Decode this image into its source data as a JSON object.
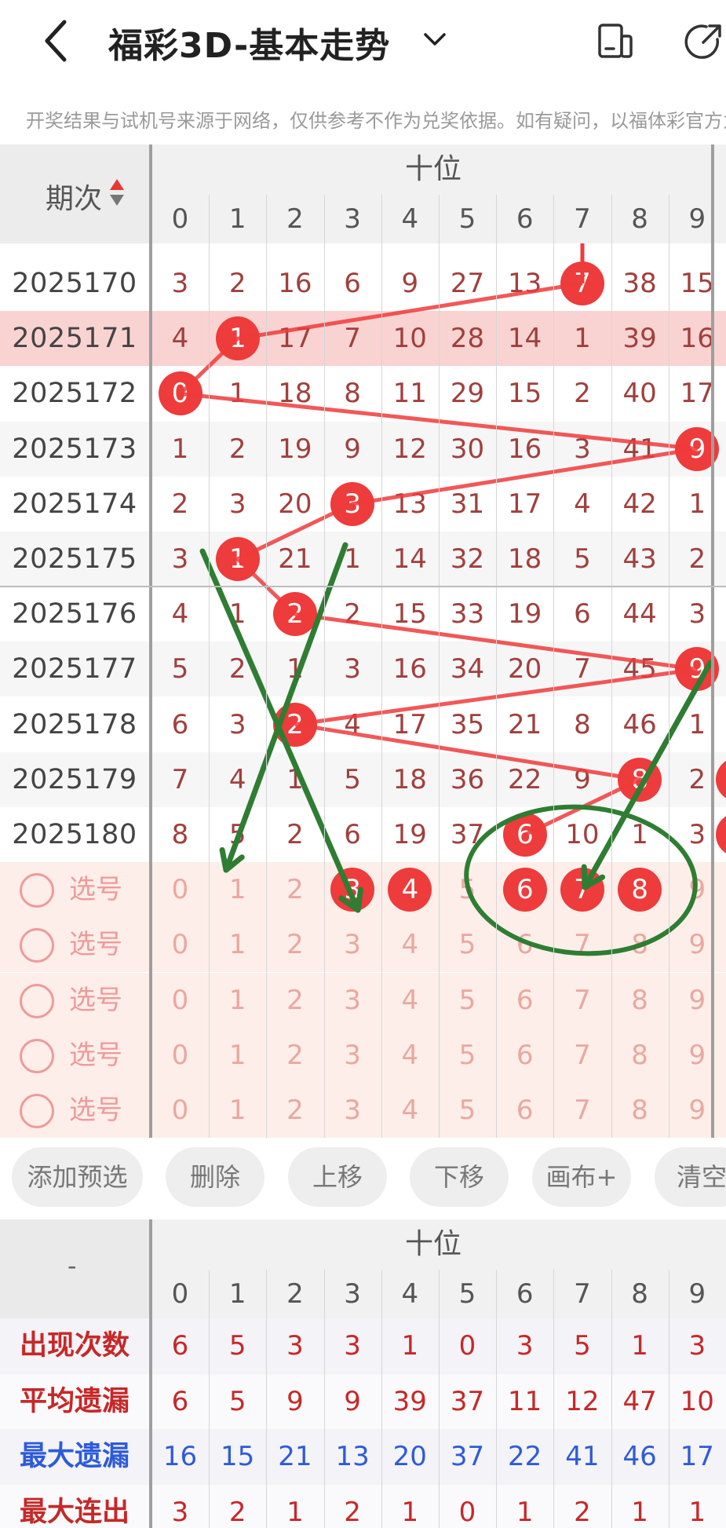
{
  "header": {
    "title": "福彩3D-基本走势",
    "notice": "开奖结果与试机号来源于网络，仅供参考不作为兑奖依据。如有疑问，以福体彩官方为准"
  },
  "colors": {
    "accent": "#ee3b3b",
    "highlight_row": "#f9d3d2",
    "select_bg": "#fdeee9",
    "annotation_green": "#2e7d32",
    "stat_red": "#c62828",
    "stat_blue": "#2e5bd8"
  },
  "table": {
    "issue_label": "期次",
    "group_label": "十位",
    "digits": [
      "0",
      "1",
      "2",
      "3",
      "4",
      "5",
      "6",
      "7",
      "8",
      "9"
    ],
    "rows": [
      {
        "issue": "2025170",
        "values": [
          "3",
          "2",
          "16",
          "6",
          "9",
          "27",
          "13",
          "7",
          "38",
          "15"
        ],
        "hit": 7
      },
      {
        "issue": "2025171",
        "values": [
          "4",
          "1",
          "17",
          "7",
          "10",
          "28",
          "14",
          "1",
          "39",
          "16"
        ],
        "hit": 1,
        "highlight": true
      },
      {
        "issue": "2025172",
        "values": [
          "0",
          "1",
          "18",
          "8",
          "11",
          "29",
          "15",
          "2",
          "40",
          "17"
        ],
        "hit": 0
      },
      {
        "issue": "2025173",
        "values": [
          "1",
          "2",
          "19",
          "9",
          "12",
          "30",
          "16",
          "3",
          "41",
          "9"
        ],
        "hit": 9
      },
      {
        "issue": "2025174",
        "values": [
          "2",
          "3",
          "20",
          "3",
          "13",
          "31",
          "17",
          "4",
          "42",
          "1"
        ],
        "hit": 3
      },
      {
        "issue": "2025175",
        "values": [
          "3",
          "1",
          "21",
          "1",
          "14",
          "32",
          "18",
          "5",
          "43",
          "2"
        ],
        "hit": 1
      },
      {
        "issue": "2025176",
        "values": [
          "4",
          "1",
          "2",
          "2",
          "15",
          "33",
          "19",
          "6",
          "44",
          "3"
        ],
        "hit": 2
      },
      {
        "issue": "2025177",
        "values": [
          "5",
          "2",
          "1",
          "3",
          "16",
          "34",
          "20",
          "7",
          "45",
          "9"
        ],
        "hit": 9
      },
      {
        "issue": "2025178",
        "values": [
          "6",
          "3",
          "2",
          "4",
          "17",
          "35",
          "21",
          "8",
          "46",
          "1"
        ],
        "hit": 2
      },
      {
        "issue": "2025179",
        "values": [
          "7",
          "4",
          "1",
          "5",
          "18",
          "36",
          "22",
          "9",
          "8",
          "2"
        ],
        "hit": 8
      },
      {
        "issue": "2025180",
        "values": [
          "8",
          "5",
          "2",
          "6",
          "19",
          "37",
          "6",
          "10",
          "1",
          "3"
        ],
        "hit": 6
      }
    ],
    "pick_label": "选号",
    "pick_rows": [
      {
        "selected": [
          3,
          4,
          6,
          7,
          8
        ]
      },
      {
        "selected": []
      },
      {
        "selected": []
      },
      {
        "selected": []
      },
      {
        "selected": []
      }
    ]
  },
  "buttons": [
    "添加预选",
    "删除",
    "上移",
    "下移",
    "画布+",
    "清空"
  ],
  "stats": {
    "dash": "-",
    "group_label": "十位",
    "rows": [
      {
        "label": "出现次数",
        "color": "red",
        "values": [
          "6",
          "5",
          "3",
          "3",
          "1",
          "0",
          "3",
          "5",
          "1",
          "3"
        ]
      },
      {
        "label": "平均遗漏",
        "color": "red",
        "values": [
          "6",
          "5",
          "9",
          "9",
          "39",
          "37",
          "11",
          "12",
          "47",
          "10"
        ]
      },
      {
        "label": "最大遗漏",
        "color": "blue",
        "values": [
          "16",
          "15",
          "21",
          "13",
          "20",
          "37",
          "22",
          "41",
          "46",
          "17"
        ]
      },
      {
        "label": "最大连出",
        "color": "red",
        "values": [
          "3",
          "2",
          "1",
          "2",
          "1",
          "0",
          "1",
          "2",
          "1",
          "1"
        ]
      }
    ]
  }
}
